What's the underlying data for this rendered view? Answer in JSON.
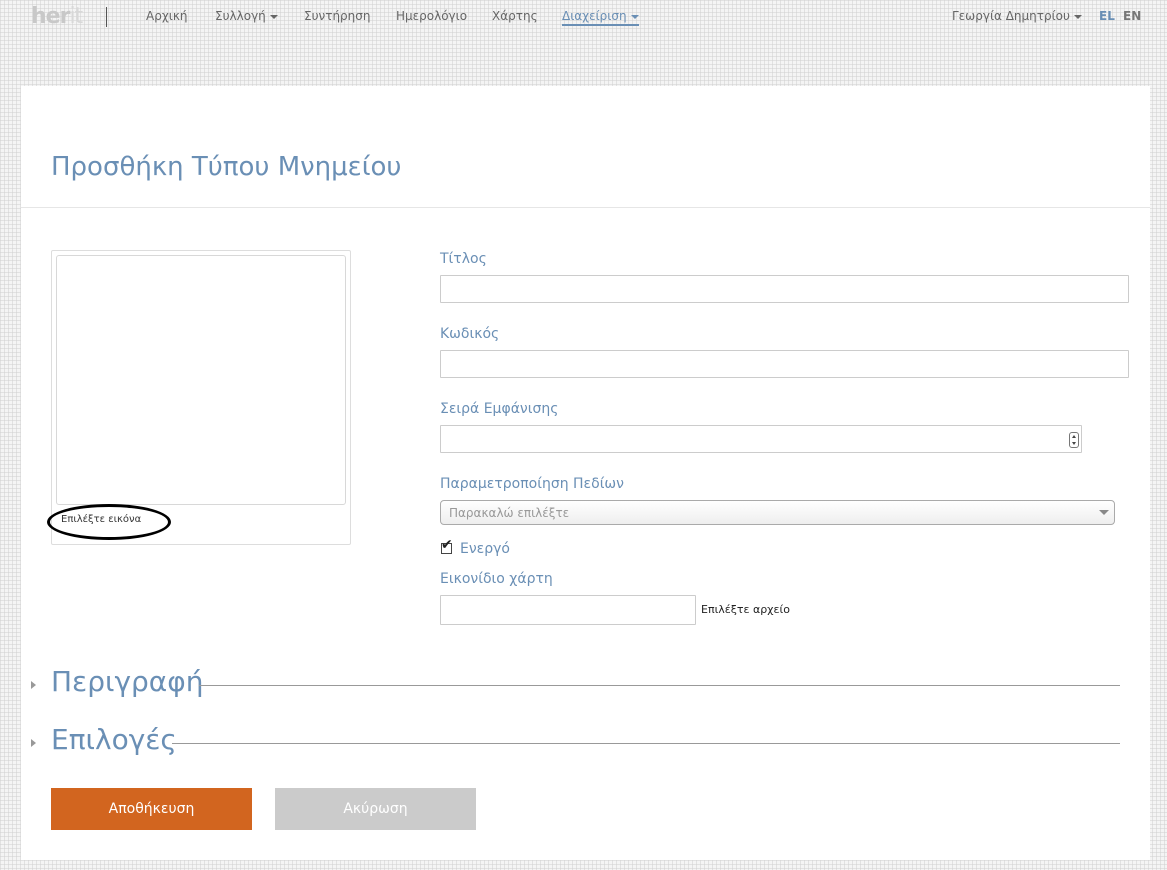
{
  "header": {
    "logo_main": "her",
    "logo_tail": "it",
    "nav": [
      {
        "label": "Αρχική",
        "dropdown": false,
        "active": false
      },
      {
        "label": "Συλλογή",
        "dropdown": true,
        "active": false
      },
      {
        "label": "Συντήρηση",
        "dropdown": false,
        "active": false
      },
      {
        "label": "Ημερολόγιο",
        "dropdown": false,
        "active": false
      },
      {
        "label": "Χάρτης",
        "dropdown": false,
        "active": false
      },
      {
        "label": "Διαχείριση",
        "dropdown": true,
        "active": true
      }
    ],
    "user": "Γεωργία Δημητρίου",
    "languages": [
      {
        "code": "EL",
        "active": true
      },
      {
        "code": "EN",
        "active": false
      }
    ]
  },
  "page": {
    "title": "Προσθήκη Τύπου Μνημείου"
  },
  "image_picker": {
    "label": "Επιλέξτε εικόνα"
  },
  "form": {
    "title_label": "Τίτλος",
    "title_value": "",
    "code_label": "Κωδικός",
    "code_value": "",
    "order_label": "Σειρά Εμφάνισης",
    "order_value": "",
    "fields_label": "Παραμετροποίηση Πεδίων",
    "fields_placeholder": "Παρακαλώ επιλέξτε",
    "active_label": "Ενεργό",
    "active_checked": true,
    "map_icon_label": "Εικονίδιο χάρτη",
    "file_button_label": "Επιλέξτε αρχείο"
  },
  "sections": [
    {
      "title": "Περιγραφή",
      "expanded": false
    },
    {
      "title": "Επιλογές",
      "expanded": false
    }
  ],
  "actions": {
    "save_label": "Αποθήκευση",
    "cancel_label": "Ακύρωση"
  },
  "colors": {
    "accent": "#6a8fb5",
    "save_button": "#d2651f",
    "cancel_button": "#cbcbcb",
    "annotation_outline": "#000000"
  }
}
